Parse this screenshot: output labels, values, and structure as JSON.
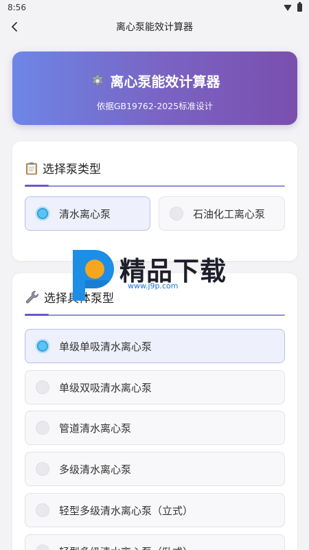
{
  "status": {
    "time": "8:56"
  },
  "nav": {
    "title": "离心泵能效计算器"
  },
  "hero": {
    "title": "离心泵能效计算器",
    "subtitle": "依据GB19762-2025标准设计"
  },
  "pump_type": {
    "title": "选择泵类型",
    "options": [
      {
        "label": "清水离心泵",
        "selected": true
      },
      {
        "label": "石油化工离心泵",
        "selected": false
      }
    ]
  },
  "pump_model": {
    "title": "选择具体泵型",
    "options": [
      {
        "label": "单级单吸清水离心泵",
        "selected": true
      },
      {
        "label": "单级双吸清水离心泵",
        "selected": false
      },
      {
        "label": "管道清水离心泵",
        "selected": false
      },
      {
        "label": "多级清水离心泵",
        "selected": false
      },
      {
        "label": "轻型多级清水离心泵（立式）",
        "selected": false
      },
      {
        "label": "轻型多级清水离心泵（卧式）",
        "selected": false
      }
    ]
  },
  "watermark": {
    "text": "精品下载",
    "url": "www.j9p.com"
  },
  "colors": {
    "accent": "#6c55c9",
    "hero_start": "#6d86e6",
    "hero_end": "#7a4fae",
    "radio_selected": "#2b9be0"
  }
}
